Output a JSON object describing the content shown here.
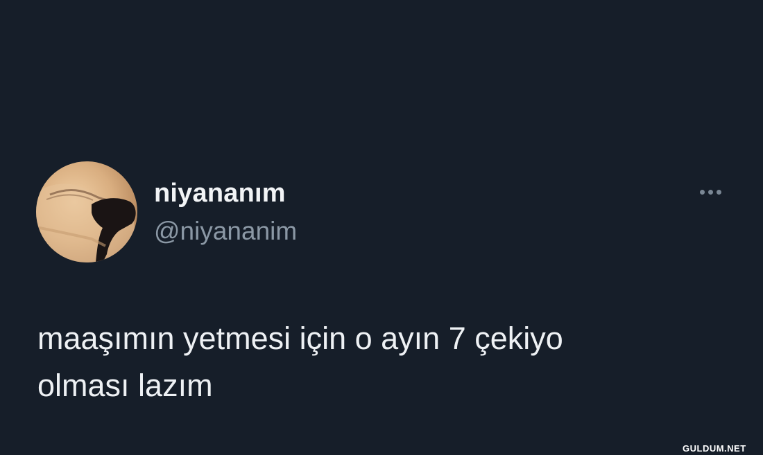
{
  "author": {
    "display_name": "niyananım",
    "handle": "@niyananim",
    "avatar_icon": "profile-photo"
  },
  "menu": {
    "icon": "more-horizontal-icon"
  },
  "tweet": {
    "line1": "maaşımın yetmesi için o ayın 7 çekiyo",
    "line2": "olması lazım"
  },
  "watermark": {
    "text": "GULDUM.NET"
  },
  "colors": {
    "background": "#161e29",
    "text_primary": "#eef1f4",
    "text_secondary": "#8b98a5"
  }
}
